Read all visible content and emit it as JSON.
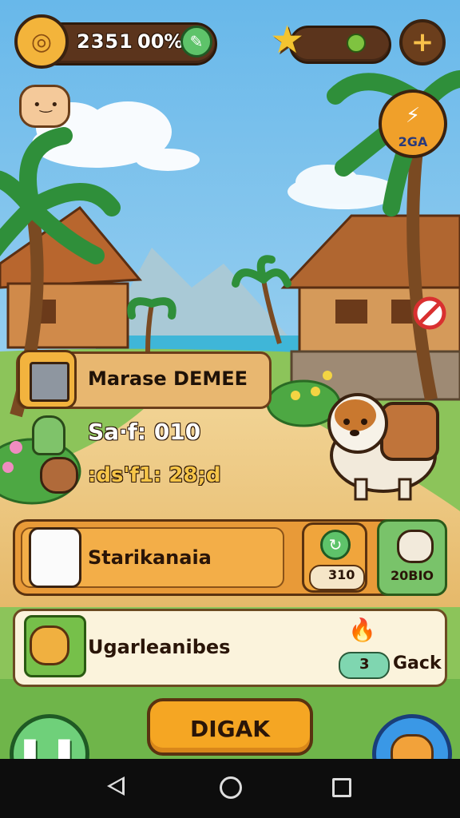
{
  "hud": {
    "coins": "2351",
    "percent": "00%",
    "star_level": "",
    "badge_timer": "2GA"
  },
  "quest": {
    "title": "Marase DEMEE",
    "stat_line": "Sa·f: 010",
    "reward_line": ":ds'f1: 28;d"
  },
  "action_panel": {
    "label": "Starikanaia",
    "cost_value": "310",
    "pet_value": "20BIO"
  },
  "info_panel": {
    "label": "Ugarleanibes",
    "chip_value": "3",
    "back_label": "Gack"
  },
  "buttons": {
    "main_label": "DIGAK"
  },
  "colors": {
    "sky": "#7fc6ee",
    "wood": "#e8a038",
    "panel_cream": "#fbf3dc",
    "green_button": "#5ec36a",
    "orange_button": "#f5a623",
    "blue_button": "#2f8fe0"
  }
}
